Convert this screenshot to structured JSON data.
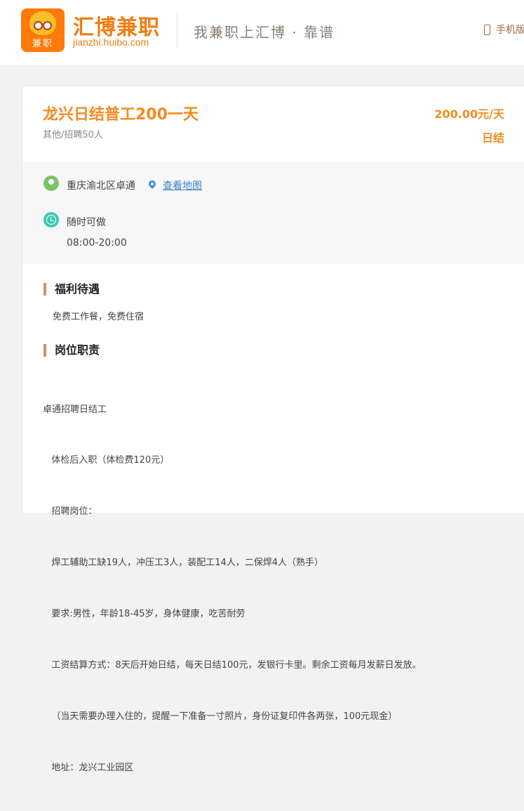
{
  "header": {
    "logo_text": "兼职",
    "brand_name": "汇博兼职",
    "brand_url": "jianzhi.huibo.com",
    "slogan": "我兼职上汇博 · 靠谱",
    "mobile_link": "手机版",
    "mobile_icon": "phone-icon"
  },
  "job": {
    "title": "龙兴日结普工200一天",
    "subtitle": "其他/招聘50人",
    "salary": "200.00元/天",
    "pay_type": "日结",
    "address": "重庆渝北区卓通",
    "map_link": "查看地图",
    "time_type": "随时可做",
    "time_range": "08:00-20:00"
  },
  "sections": {
    "benefits_title": "福利待遇",
    "benefits_text": "免费工作餐，免费住宿",
    "duties_title": "岗位职责",
    "duties_lines": [
      "卓通招聘日结工",
      "   体检后入职（体检费120元）",
      "   招聘岗位：",
      "   焊工辅助工缺19人，冲压工3人，装配工14人，二保焊4人（熟手）",
      "   要求:男性，年龄18-45岁，身体健康，吃苦耐劳",
      "   工资结算方式：8天后开始日结，每天日结100元，发银行卡里。剩余工资每月发薪日发放。",
      "   （当天需要办理入住的，提醒一下准备一寸照片，身份证复印件各两张，100元现金）",
      "   地址：龙兴工业园区"
    ]
  },
  "colors": {
    "accent": "#f58b1f",
    "link": "#3a7fd0",
    "location_icon": "#7cc26a",
    "clock_icon": "#3fc8b4"
  }
}
